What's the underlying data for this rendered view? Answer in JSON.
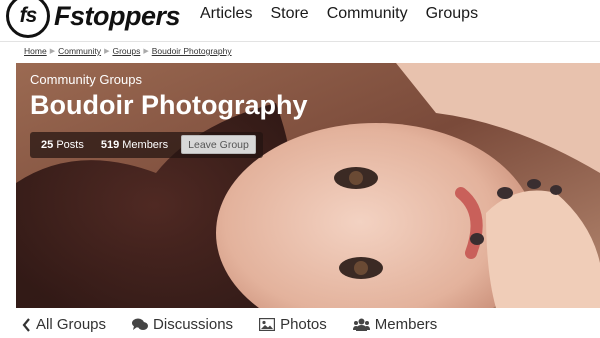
{
  "header": {
    "logo_mark": "fs",
    "logo_text": "Fstoppers",
    "nav": [
      "Articles",
      "Store",
      "Community",
      "Groups"
    ]
  },
  "breadcrumb": {
    "items": [
      "Home",
      "Community",
      "Groups",
      "Boudoir Photography"
    ],
    "separator_icon": "chevron-right-icon"
  },
  "hero": {
    "subtitle": "Community Groups",
    "title": "Boudoir Photography",
    "posts_count": "25",
    "posts_label": "Posts",
    "members_count": "519",
    "members_label": "Members",
    "leave_button": "Leave Group"
  },
  "tabs": [
    {
      "label": "All Groups",
      "icon": "chevron-left-icon"
    },
    {
      "label": "Discussions",
      "icon": "chat-bubbles-icon"
    },
    {
      "label": "Photos",
      "icon": "photo-icon"
    },
    {
      "label": "Members",
      "icon": "users-icon"
    }
  ],
  "colors": {
    "hero_background": "#8a5a44",
    "text_dark": "#1a1a1a",
    "button_background": "#d8d8d8"
  }
}
